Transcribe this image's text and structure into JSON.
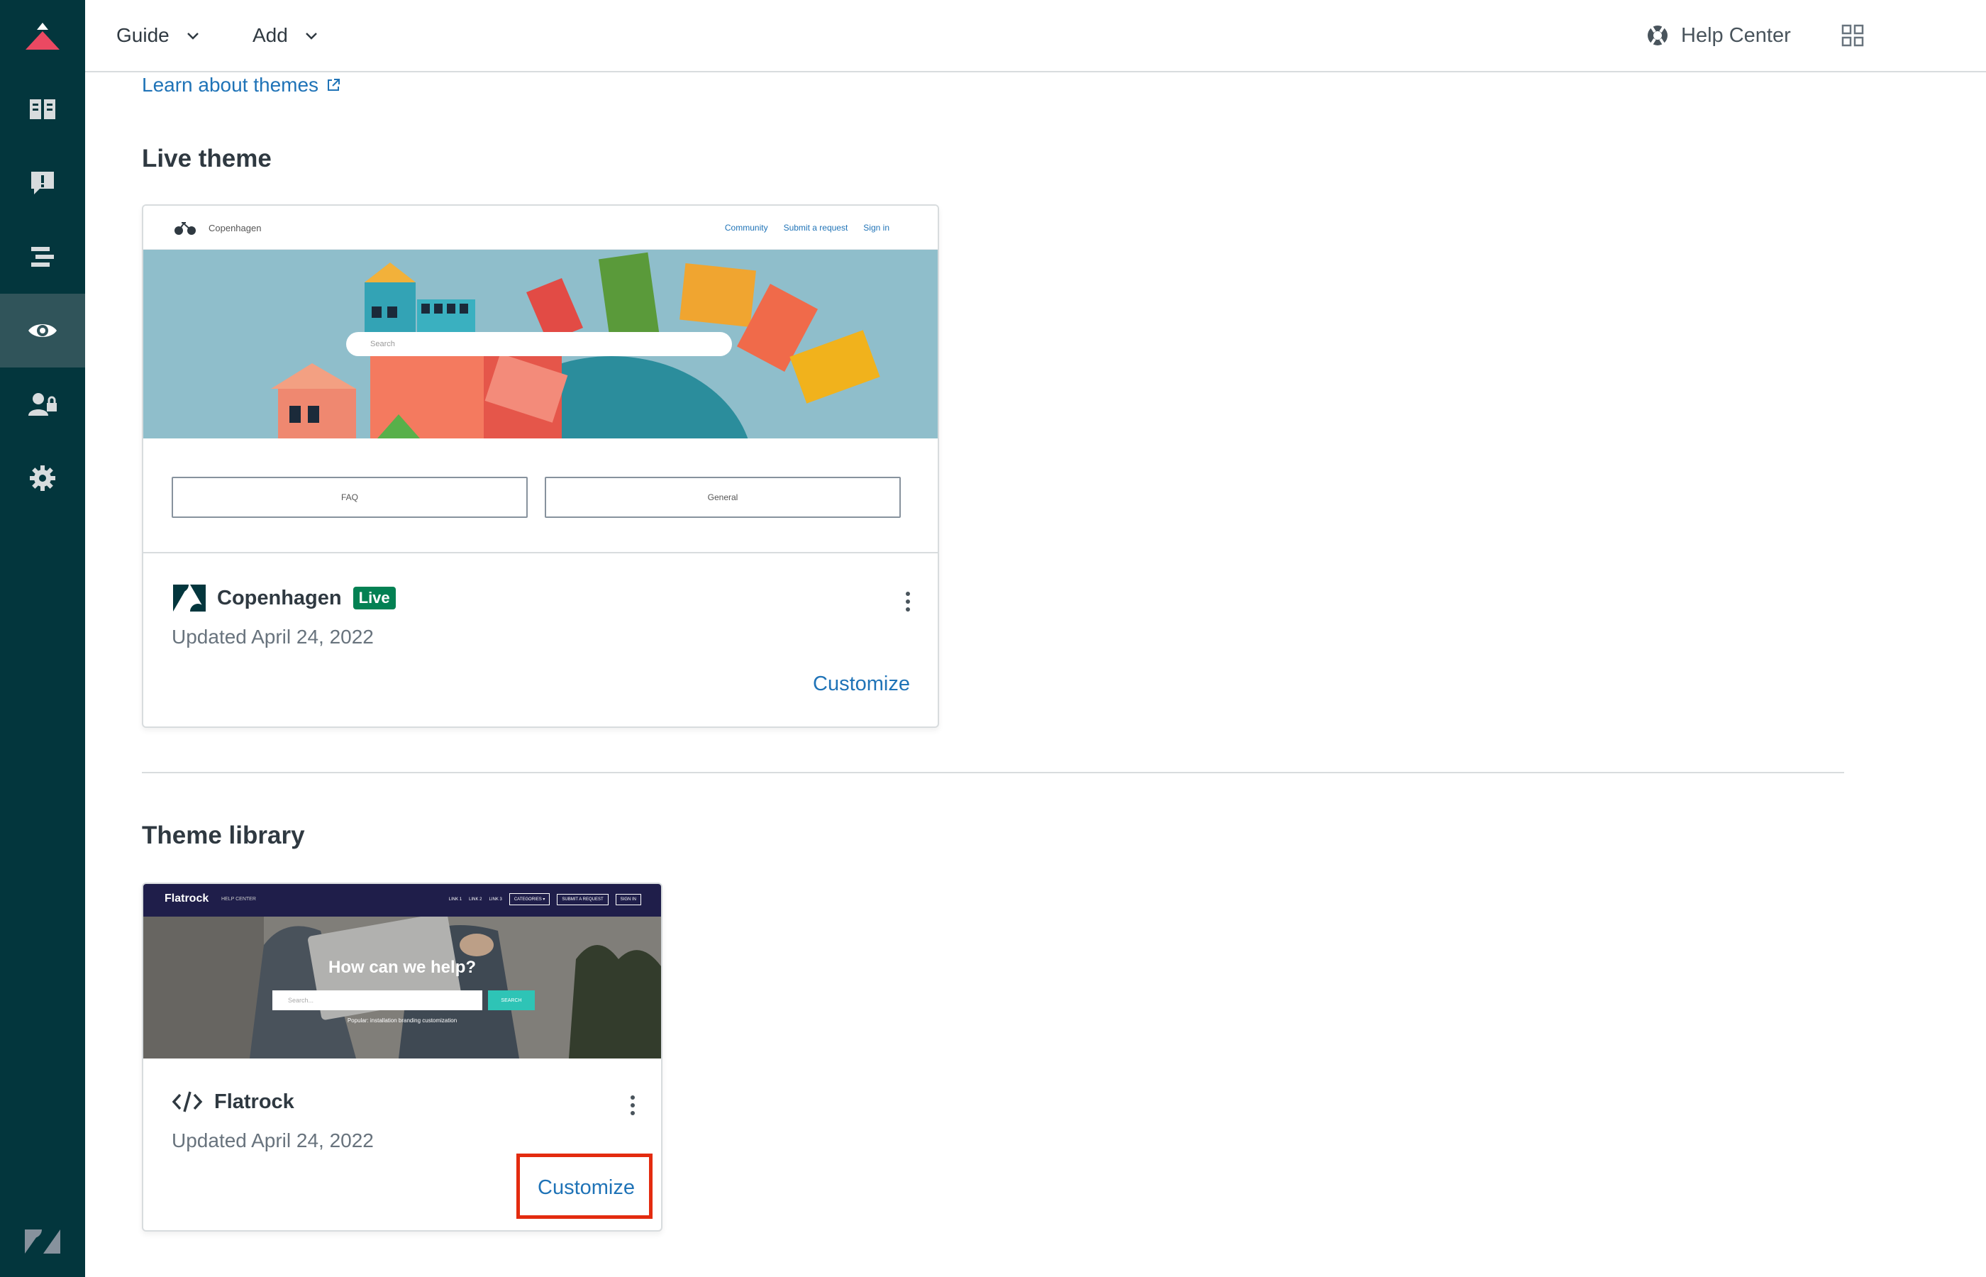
{
  "topbar": {
    "menus": [
      {
        "label": "Guide"
      },
      {
        "label": "Add"
      }
    ],
    "help_center": "Help Center"
  },
  "content": {
    "learn_link": "Learn about themes",
    "live_section_title": "Live theme",
    "library_section_title": "Theme library"
  },
  "live_theme": {
    "name": "Copenhagen",
    "badge": "Live",
    "updated": "Updated April 24, 2022",
    "customize": "Customize",
    "preview": {
      "brand": "Copenhagen",
      "nav_links": [
        "Community",
        "Submit a request",
        "Sign in"
      ],
      "search_placeholder": "Search",
      "categories": [
        "FAQ",
        "General"
      ]
    }
  },
  "library_theme": {
    "name": "Flatrock",
    "updated": "Updated April 24, 2022",
    "customize": "Customize",
    "preview": {
      "brand": "Flatrock",
      "sub": "HELP CENTER",
      "nav_links": [
        "LINK 1",
        "LINK 2",
        "LINK 3"
      ],
      "nav_buttons": [
        "CATEGORIES ▾",
        "SUBMIT A REQUEST",
        "SIGN IN"
      ],
      "headline": "How can we help?",
      "search_placeholder": "Search...",
      "search_button": "SEARCH",
      "popular": "Popular:  installation  branding  customization"
    }
  },
  "colors": {
    "sidebar": "#03363d",
    "sidebar_active": "#30545a",
    "link": "#1f73b7",
    "live_badge": "#038153",
    "highlight": "#e32b0f"
  }
}
